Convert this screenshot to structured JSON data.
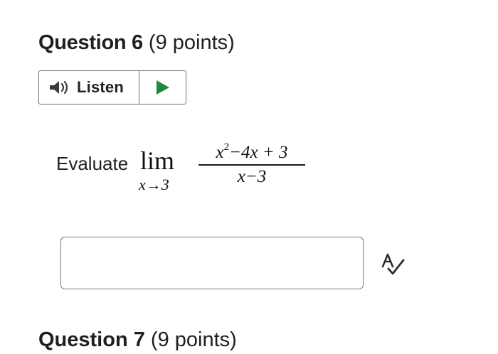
{
  "question": {
    "label": "Question 6",
    "points": " (9 points)"
  },
  "listen": {
    "label": "Listen",
    "speaker_icon": "speaker-icon",
    "play_icon": "play-icon",
    "play_color": "#1e8a3c"
  },
  "prompt": {
    "verb": "Evaluate",
    "limit_word": "lim",
    "limit_subscript": "x→3",
    "numerator_a": "x",
    "numerator_exp": "2",
    "numerator_rest": "−4x + 3",
    "denominator": "x−3"
  },
  "answer": {
    "value": "",
    "placeholder": ""
  },
  "tools": {
    "spellcheck_icon": "spellcheck-icon"
  },
  "next_question": {
    "label": "Question 7",
    "points": " (9 points)"
  }
}
